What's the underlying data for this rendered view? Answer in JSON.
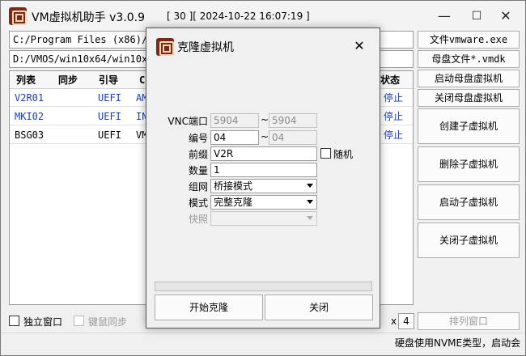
{
  "app": {
    "title": "VM虚拟机助手 v3.0.9",
    "info": "[ 30 ][ 2024-10-22 16:07:19 ]",
    "min": "—",
    "max": "☐",
    "close": "✕"
  },
  "paths": {
    "program": "C:/Program Files (x86)/V",
    "vmos": "D:/VMOS/win10x64/win10x6"
  },
  "right_buttons": {
    "vmware": "文件vmware.exe",
    "vmdk": "母盘文件*.vmdk",
    "start_master": "启动母盘虚拟机",
    "close_master": "关闭母盘虚拟机",
    "create_child": "创建子虚拟机",
    "delete_child": "删除子虚拟机",
    "start_child": "启动子虚拟机",
    "close_child": "关闭子虚拟机",
    "arrange": "排列窗口"
  },
  "table": {
    "headers": [
      "列表",
      "同步",
      "引导",
      "C",
      "状态"
    ],
    "rows": [
      {
        "name": "V2R01",
        "sync": "",
        "boot": "UEFI",
        "c": "AM",
        "status": "停止",
        "color": "#1f3fb0"
      },
      {
        "name": "MKI02",
        "sync": "",
        "boot": "UEFI",
        "c": "IN",
        "status": "停止",
        "color": "#1f3fb0"
      },
      {
        "name": "BSG03",
        "sync": "",
        "boot": "UEFI",
        "c": "VM",
        "status": "停止",
        "color": "#000000"
      }
    ]
  },
  "bottom": {
    "independent_window": "独立窗口",
    "keyboard_mouse_sync": "键鼠同步",
    "grid_x": "x",
    "grid_cols": "4"
  },
  "status_bar": "硬盘使用NVME类型，启动会",
  "dialog": {
    "title": "克隆虚拟机",
    "close": "✕",
    "fields": {
      "vnc_label": "VNC端口",
      "vnc_from": "5904",
      "vnc_to": "5904",
      "tilde": "~",
      "number_label": "编号",
      "number_from": "04",
      "number_to": "04",
      "prefix_label": "前缀",
      "prefix_value": "V2R",
      "random_label": "随机",
      "count_label": "数量",
      "count_value": "1",
      "network_label": "组网",
      "network_value": "桥接模式",
      "mode_label": "模式",
      "mode_value": "完整克隆",
      "snapshot_label": "快照",
      "snapshot_value": ""
    },
    "start_button": "开始克隆",
    "close_button": "关闭"
  }
}
